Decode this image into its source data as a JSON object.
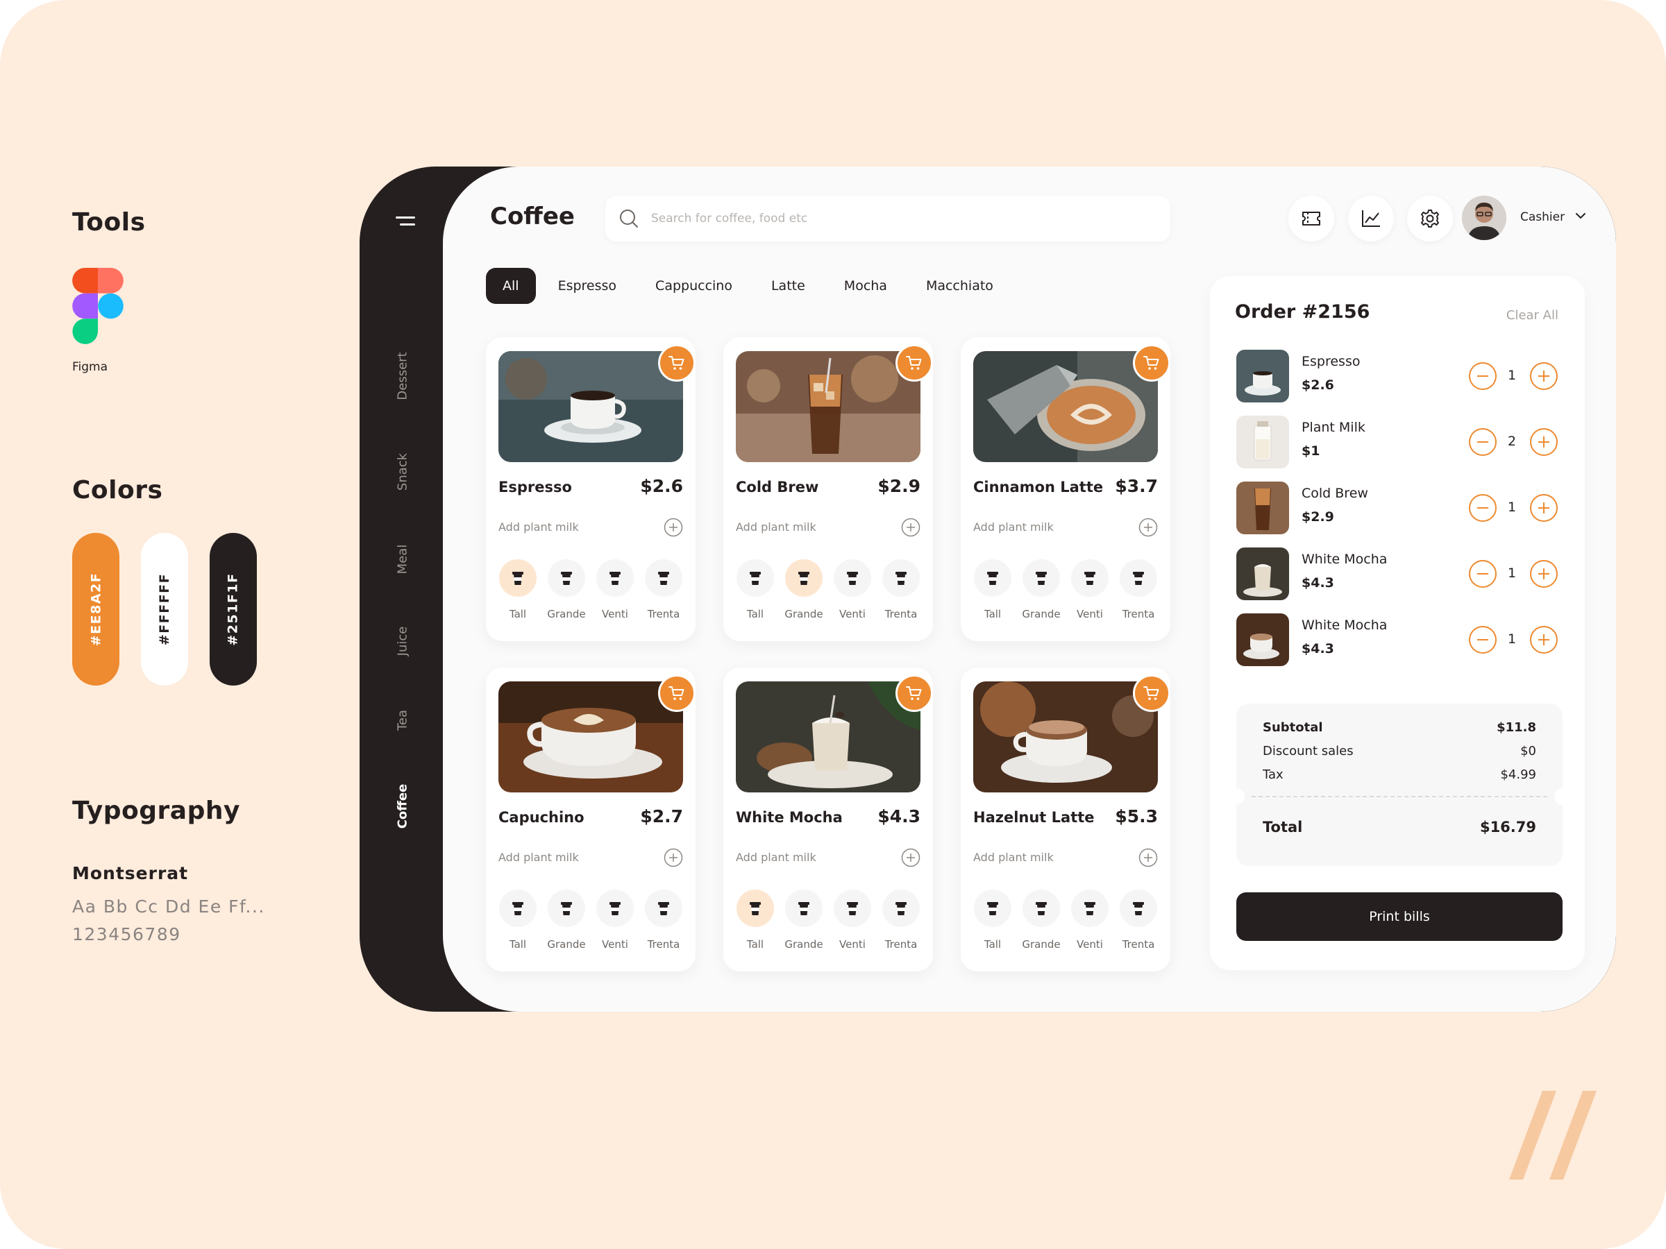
{
  "guide": {
    "tools_title": "Tools",
    "figma_label": "Figma",
    "colors_title": "Colors",
    "swatches": [
      {
        "label": "#EE8A2F",
        "color": "#EE8A2F"
      },
      {
        "label": "#FFFFFF",
        "color": "#FFFFFF"
      },
      {
        "label": "#251F1F",
        "color": "#251F1F"
      }
    ],
    "typography_title": "Typography",
    "font_name": "Montserrat",
    "font_sample_letters": "Aa Bb Cc Dd Ee Ff...",
    "font_sample_numbers": "123456789"
  },
  "sidebar": {
    "categories": [
      "Dessert",
      "Snack",
      "Meal",
      "Juice",
      "Tea",
      "Coffee"
    ],
    "active": "Coffee"
  },
  "header": {
    "title": "Coffee",
    "search_placeholder": "Search for coffee, food etc",
    "user_role": "Cashier"
  },
  "filters": [
    "All",
    "Espresso",
    "Cappuccino",
    "Latte",
    "Mocha",
    "Macchiato"
  ],
  "active_filter": "All",
  "products": [
    {
      "name": "Espresso",
      "price": "$2.6",
      "milk": "Add plant milk",
      "selected_size": "Tall"
    },
    {
      "name": "Cold Brew",
      "price": "$2.9",
      "milk": "Add plant milk",
      "selected_size": "Grande"
    },
    {
      "name": "Cinnamon Latte",
      "price": "$3.7",
      "milk": "Add plant milk",
      "selected_size": ""
    },
    {
      "name": "Capuchino",
      "price": "$2.7",
      "milk": "Add plant milk",
      "selected_size": ""
    },
    {
      "name": "White Mocha",
      "price": "$4.3",
      "milk": "Add plant milk",
      "selected_size": "Tall"
    },
    {
      "name": "Hazelnut Latte",
      "price": "$5.3",
      "milk": "Add plant milk",
      "selected_size": ""
    }
  ],
  "sizes": [
    "Tall",
    "Grande",
    "Venti",
    "Trenta"
  ],
  "order": {
    "title": "Order #2156",
    "clear_label": "Clear All",
    "items": [
      {
        "name": "Espresso",
        "price": "$2.6",
        "qty": "1"
      },
      {
        "name": "Plant Milk",
        "price": "$1",
        "qty": "2"
      },
      {
        "name": "Cold Brew",
        "price": "$2.9",
        "qty": "1"
      },
      {
        "name": "White Mocha",
        "price": "$4.3",
        "qty": "1"
      },
      {
        "name": "White Mocha",
        "price": "$4.3",
        "qty": "1"
      }
    ],
    "subtotal_label": "Subtotal",
    "subtotal": "$11.8",
    "discount_label": "Discount sales",
    "discount": "$0",
    "tax_label": "Tax",
    "tax": "$4.99",
    "total_label": "Total",
    "total": "$16.79",
    "print_label": "Print bills"
  }
}
